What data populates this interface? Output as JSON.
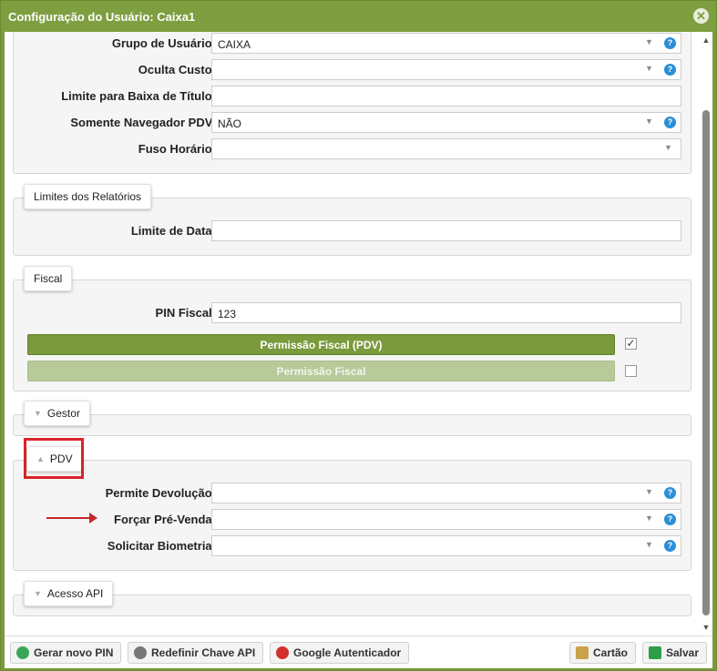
{
  "dialog": {
    "title": "Configuração do Usuário: Caixa1"
  },
  "general": {
    "rows": [
      {
        "label": "Grupo de Usuário:",
        "value": "CAIXA"
      },
      {
        "label": "Oculta Custo:",
        "value": ""
      },
      {
        "label": "Limite para Baixa de Título:",
        "value": ""
      },
      {
        "label": "Somente Navegador PDV:",
        "value": "NÃO"
      },
      {
        "label": "Fuso Horário:",
        "value": ""
      }
    ]
  },
  "reports": {
    "legend": "Limites dos Relatórios",
    "date_limit_label": "Limite de Data:",
    "date_limit_value": ""
  },
  "fiscal": {
    "legend": "Fiscal",
    "pin_label": "PIN Fiscal:",
    "pin_value": "123",
    "perm_pdv_label": "Permissão Fiscal (PDV)",
    "perm_pdv_checked": true,
    "perm_label": "Permissão Fiscal",
    "perm_checked": false
  },
  "gestor": {
    "legend": "Gestor"
  },
  "pdv": {
    "legend": "PDV",
    "rows": [
      {
        "label": "Permite Devolução:",
        "value": ""
      },
      {
        "label": "Forçar Pré-Venda:",
        "value": ""
      },
      {
        "label": "Solicitar Biometria:",
        "value": ""
      }
    ]
  },
  "api": {
    "legend": "Acesso API"
  },
  "footer": {
    "gen_pin": "Gerar novo PIN",
    "reset_api": "Redefinir Chave API",
    "google_auth": "Google Autenticador",
    "card": "Cartão",
    "save": "Salvar"
  },
  "colors": {
    "accent": "#7a9a3c",
    "help": "#2a8fd8",
    "highlight": "#d9232a"
  }
}
